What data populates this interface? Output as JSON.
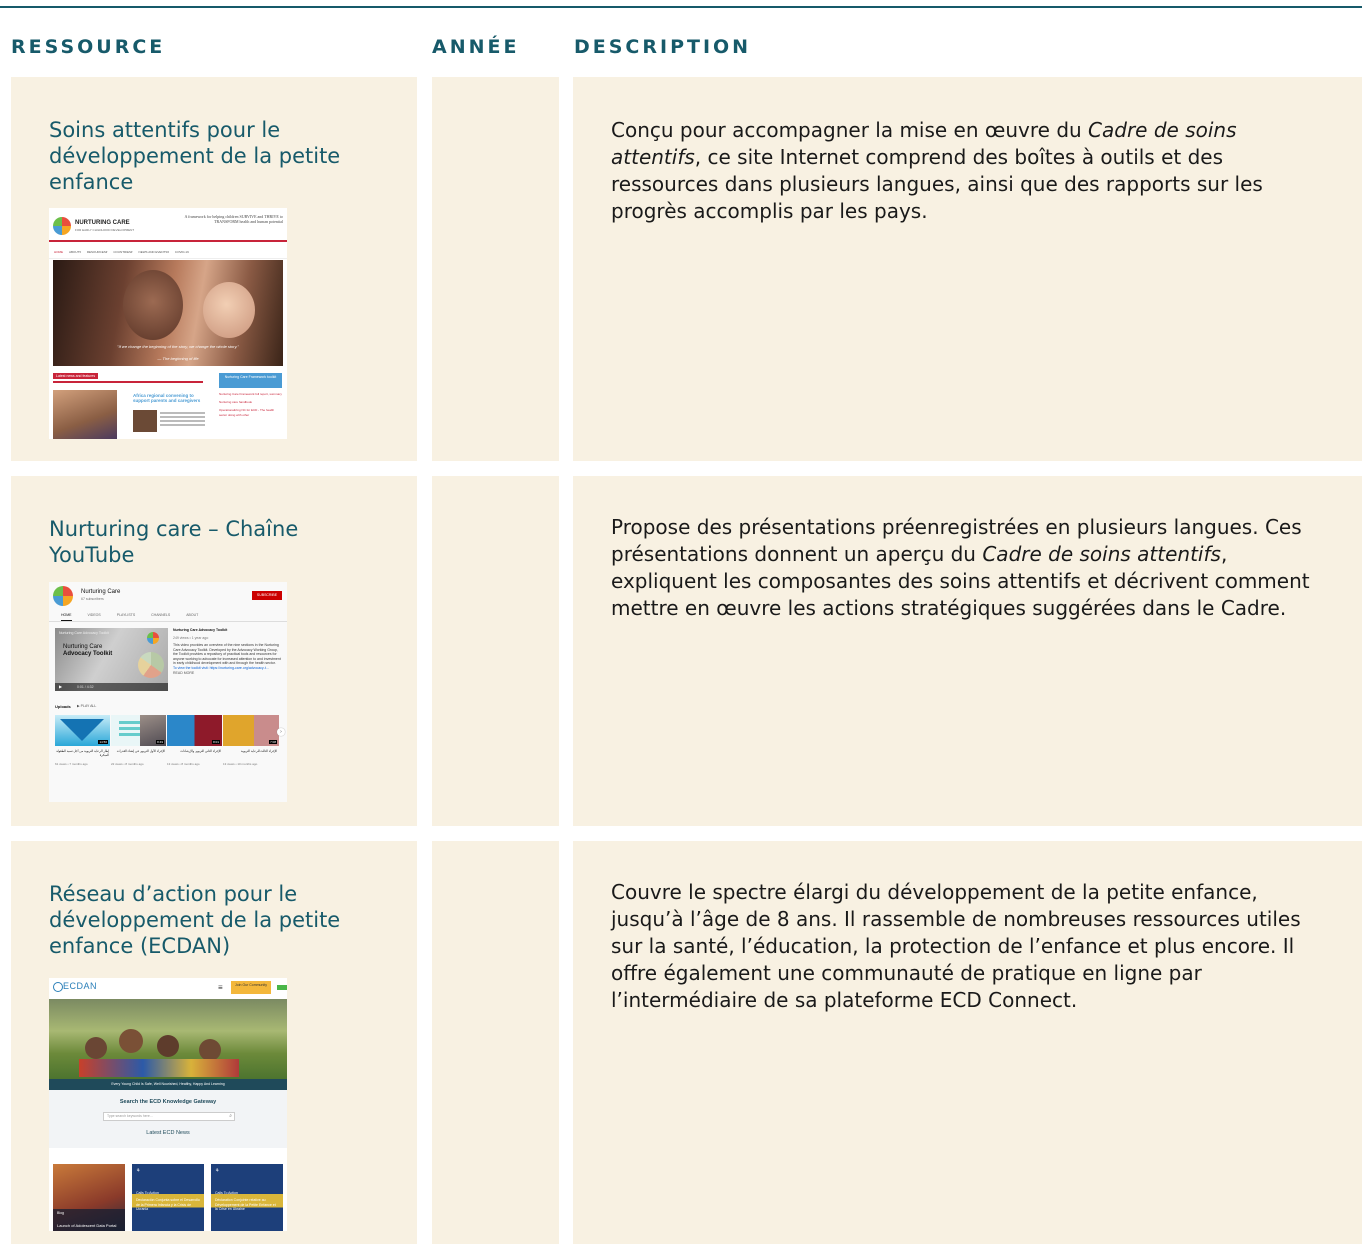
{
  "headers": {
    "resource": "RESSOURCE",
    "year": "ANNÉE",
    "description": "DESCRIPTION"
  },
  "rows": [
    {
      "title": "Soins attentifs pour le développement de la petite enfance",
      "year": "",
      "desc_before": "Conçu pour accompagner la mise en œuvre du ",
      "desc_italic": "Cadre de soins attentifs",
      "desc_after": ", ce site Internet comprend des boîtes à outils et des ressources dans plusieurs langues, ainsi que des rapports sur les progrès accomplis par les pays.",
      "shot": {
        "brand": "NURTURING CARE",
        "brand_sub": "FOR EARLY CHILDHOOD DEVELOPMENT",
        "tagline": "A framework for helping children SURVIVE and THRIVE to TRANSFORM health and human potential",
        "nav": [
          "HOME",
          "ABOUT▾",
          "RESOURCES▾",
          "COUNTRIES▾",
          "NEWS AND EVENTS▾",
          "COVID-19"
        ],
        "quote": "\"If we change the beginning of the story, we change the whole story.\"",
        "quote_src": "— The beginning of life",
        "news_label": "Latest news and features",
        "framework_label": "Nurturing Care Framework toolkit",
        "news_title": "Africa regional convening to support parents and caregivers",
        "side_links": [
          "Nurturing Care Framework full report, summary",
          "Nurturing care handbook",
          "Operationalizing NC for ECD - The health sector doing with other"
        ]
      }
    },
    {
      "title": "Nurturing care – Chaîne YouTube",
      "year": "",
      "desc_before": "Propose des présentations préenregistrées en plusieurs langues. Ces présentations donnent un aperçu du ",
      "desc_italic": "Cadre de soins attentifs",
      "desc_after": ", expliquent les composantes des soins attentifs et décrivent comment mettre en œuvre les actions stratégiques suggérées dans le Cadre.",
      "shot": {
        "channel": "Nurturing Care",
        "subs": "67 subscribers",
        "subscribe": "SUBSCRIBE",
        "tabs": [
          "HOME",
          "VIDEOS",
          "PLAYLISTS",
          "CHANNELS",
          "ABOUT"
        ],
        "video_small": "Nurturing Care Advocacy Toolkit",
        "video_title_1": "Nurturing Care",
        "video_title_2": "Advocacy Toolkit",
        "video_time": "0:01 / 4:32",
        "info_title": "Nurturing Care Advocacy Toolkit",
        "info_meta": "249 views • 1 year ago",
        "info_body": "This video provides an overview of the nine sections in the Nurturing Care Advocacy Toolkit. Developed by the Advocacy Working Group, the Toolkit provides a repository of practical tools and resources for anyone working to advocate for increased attention to and investment in early childhood development with and through the health sector.",
        "info_link": "To view the toolkit visit: https://nurturing-care.org/advocacy-t...",
        "read_more": "READ MORE",
        "uploads": "Uploads",
        "play_all": "▶  PLAY ALL",
        "durations": [
          "14:56",
          "8:49",
          "8:01",
          "7:08"
        ],
        "captions": [
          "إطار الرعاية التربوية من أجل تنمية الطفولة المبكرة",
          "الإجراء الأول التربوي في إنشاء القدرات",
          "الإجراء الثاني التربوي والإرشادات",
          "الإجراء الثالث للرعاية التربوية"
        ],
        "meta": [
          "61 views • 7 months ago",
          "22 views • 8 months ago",
          "13 views • 8 months ago",
          "13 views • 10 months ago"
        ]
      }
    },
    {
      "title": "Réseau d’action pour le développement de la petite enfance (ECDAN)",
      "year": "",
      "desc_before": "Couvre le spectre élargi du développement de la petite enfance, jusqu’à l’âge de 8 ans. Il rassemble de nombreuses ressources utiles sur la santé, l’éducation, la protection de l’enfance et plus encore. Il offre également une communauté de pratique en ligne par l’intermédiaire de sa plateforme ECD Connect.",
      "desc_italic": "",
      "desc_after": "",
      "shot": {
        "logo": "ECDAN",
        "join": "Join Our Community",
        "hero_caption": "Every Young Child Is Safe, Well Nourished, Healthy, Happy And Learning",
        "search_title": "Search the ECD Knowledge Gateway",
        "search_placeholder": "Type search keywords here...",
        "news_title": "Latest ECD News",
        "cards": [
          {
            "tag": "Blog",
            "title": "Launch of Adolescent Data Portal"
          },
          {
            "tag": "Calls To Action",
            "title": "Declaración Conjunta sobre el Desarrollo de la Primera Infancia y la Crisis de Ucrania"
          },
          {
            "tag": "Calls To Action",
            "title": "Déclaration Conjointe relative au Développement de la Petite Enfance et la Crise en Ukraine"
          }
        ]
      }
    }
  ],
  "colors": {
    "accent": "#175a6a",
    "cell_bg": "#f8f1e2",
    "rule": "#175a6a"
  }
}
